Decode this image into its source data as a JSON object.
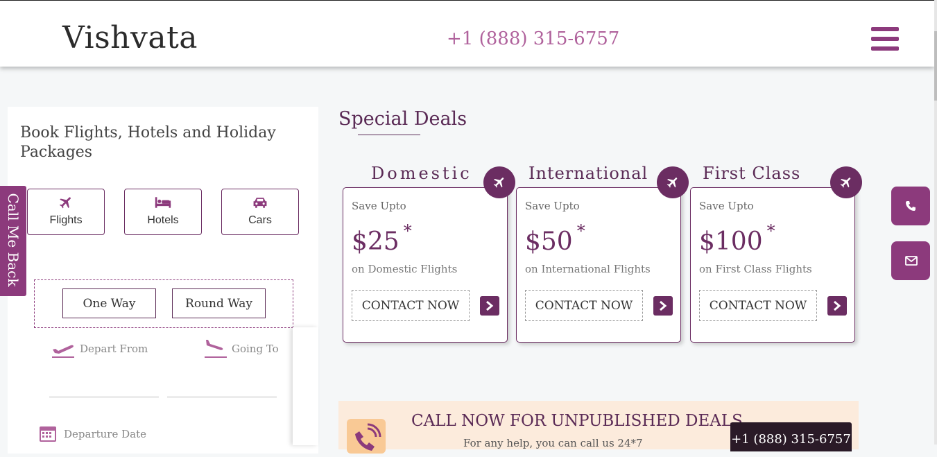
{
  "header": {
    "logo": "Vishvata",
    "phone": "+1 (888) 315-6757"
  },
  "booking": {
    "title": "Book Flights, Hotels and Holiday Packages",
    "tabs": [
      {
        "label": "Flights",
        "icon": "plane-icon"
      },
      {
        "label": "Hotels",
        "icon": "bed-icon"
      },
      {
        "label": "Cars",
        "icon": "car-icon"
      }
    ],
    "trip_types": [
      "One Way",
      "Round Way"
    ],
    "depart_from": "Depart From",
    "going_to": "Going To",
    "departure_date": "Departure Date"
  },
  "callme": {
    "label": "Call Me Back"
  },
  "deals": {
    "title": "Special Deals",
    "cards": [
      {
        "heading": "Domestic",
        "save": "Save Upto",
        "price": "$25",
        "star": "*",
        "on": "on Domestic Flights",
        "cta": "CONTACT NOW"
      },
      {
        "heading": "International",
        "save": "Save Upto",
        "price": "$50",
        "star": "*",
        "on": "on International Flights",
        "cta": "CONTACT NOW"
      },
      {
        "heading": "First Class",
        "save": "Save Upto",
        "price": "$100",
        "star": "*",
        "on": "on First Class Flights",
        "cta": "CONTACT NOW"
      }
    ]
  },
  "banner": {
    "title": "CALL NOW FOR UNPUBLISHED DEALS",
    "subtitle": "For any help, you can call us 24*7",
    "phone": "+1 (888) 315-6757"
  },
  "colors": {
    "accent": "#6b2d62",
    "accent_light": "#8c3a7c",
    "phone": "#b0629c",
    "banner_bg": "#fcebdc"
  }
}
